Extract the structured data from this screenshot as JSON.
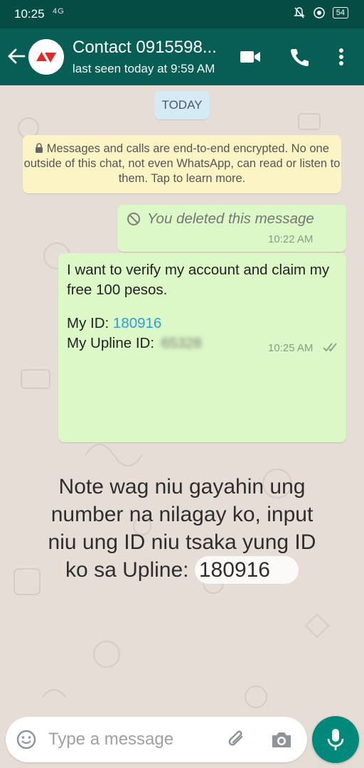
{
  "status_bar": {
    "time": "10:25",
    "network": "4G",
    "battery": "54"
  },
  "header": {
    "contact_name": "Contact 0915598...",
    "last_seen": "last seen today at 9:59 AM"
  },
  "chat": {
    "date_label": "TODAY",
    "encryption_notice": "Messages and calls are end-to-end encrypted. No one outside of this chat, not even WhatsApp, can read or listen to them. Tap to learn more.",
    "messages": [
      {
        "type": "deleted",
        "text": "You deleted this message",
        "time": "10:22 AM"
      },
      {
        "type": "text",
        "line1": "I want to verify my account and claim my free 100 pesos.",
        "my_id_label": "My ID:",
        "my_id_value": "180916",
        "upline_label": "My Upline ID:",
        "upline_blurred": "65328",
        "time": "10:25 AM",
        "status": "delivered"
      }
    ]
  },
  "overlay_note": {
    "text": "Note wag niu gayahin ung number na nilagay ko, input niu ung ID niu tsaka yung ID ko sa",
    "upline_label": "Upline:",
    "upline_value": "180916"
  },
  "input": {
    "placeholder": "Type a message"
  },
  "colors": {
    "header": "#075e54",
    "status_bar": "#054d44",
    "outgoing_bubble": "#dcf8c6",
    "link": "#2b9fd8",
    "mic_button": "#00897b"
  }
}
